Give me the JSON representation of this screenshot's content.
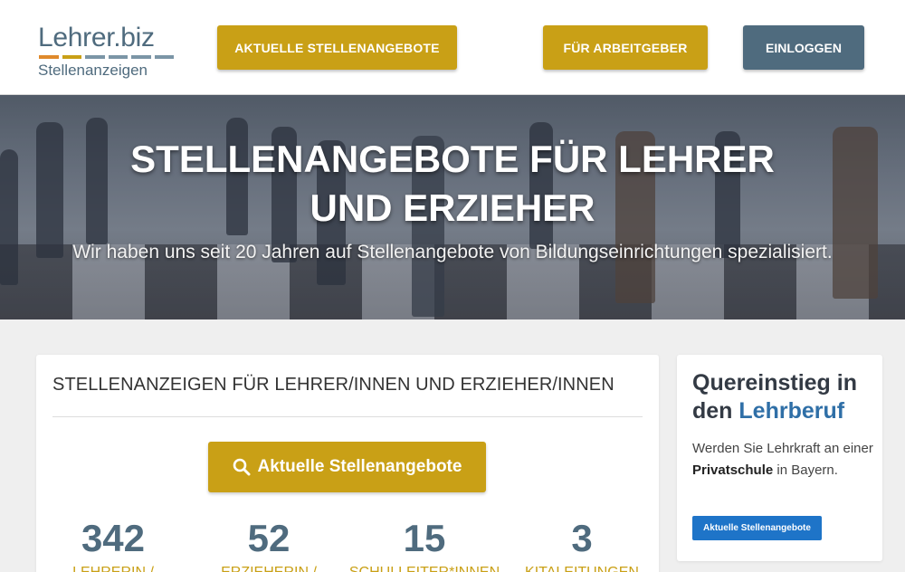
{
  "header": {
    "logo": {
      "top": "Lehrer.biz",
      "bottom": "Stellenanzeigen",
      "bar_colors": [
        "#e08a2c",
        "#c9a016",
        "#7b95a6",
        "#7b95a6",
        "#7b95a6",
        "#7b95a6"
      ]
    },
    "nav": {
      "current_jobs_label": "AKTUELLE STELLENANGEBOTE",
      "employers_label": "FÜR ARBEITGEBER",
      "login_label": "EINLOGGEN"
    }
  },
  "hero": {
    "title": "STELLENANGEBOTE FÜR LEHRER UND ERZIEHER",
    "subtitle": "Wir haben uns seit 20 Jahren auf Stellenangebote von Bildungseinrichtungen spezialisiert."
  },
  "main_card": {
    "title": "STELLENANZEIGEN FÜR LEHRER/INNEN UND ERZIEHER/INNEN",
    "search_button_label": "Aktuelle Stellenangebote",
    "stats": [
      {
        "value": "342",
        "label": "LEHRERIN /"
      },
      {
        "value": "52",
        "label": "ERZIEHERIN /"
      },
      {
        "value": "15",
        "label": "SCHULLEITER*INNEN"
      },
      {
        "value": "3",
        "label": "KITALEITUNGEN"
      }
    ]
  },
  "side_card": {
    "title_part1": "Quereinstieg in den ",
    "title_accent": "Lehrberuf",
    "text_part1": "Werden Sie Lehrkraft an einer ",
    "text_bold": "Privatschule",
    "text_part2": " in Bayern.",
    "button_label": "Aktuelle Stellenangebote"
  },
  "colors": {
    "gold": "#c9a016",
    "slate": "#4f6b7e",
    "blue": "#1e74c8",
    "accent_blue": "#2f6fa7"
  }
}
